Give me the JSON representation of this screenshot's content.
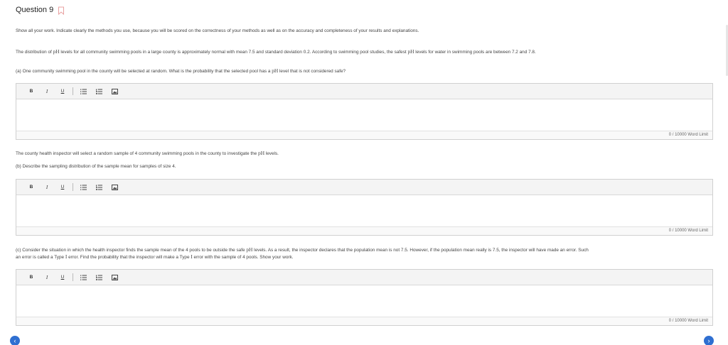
{
  "question": {
    "title": "Question 9"
  },
  "instructions": "Show all your work. Indicate clearly the methods you use, because you will be scored on the correctness of your methods as well as on the accuracy and completeness of your results and explanations.",
  "intro": {
    "part1": "The distribution of ",
    "ph": "pH",
    "part2": " levels for all community swimming pools in a large county is approximately normal with mean 7.5 and standard deviation 0.2. According to swimming pool studies, the safest ",
    "ph2": "pH",
    "part3": " levels for water in swimming pools are between 7.2 and 7.8."
  },
  "part_a": {
    "part1": "(a) One community swimming pool in the county will be selected at random. What is the probability that the selected pool has a ",
    "ph": "pH",
    "part2": " level that is not considered safe?"
  },
  "inspector": {
    "part1": "The county health inspector will select a random sample of 4 community swimming pools in the county to investigate the ",
    "ph": "pH",
    "part2": " levels."
  },
  "part_b": "(b) Describe the sampling distribution of the sample mean for samples of size 4.",
  "part_c": {
    "line1a": "(c) Consider the situation in which the health inspector finds the sample mean of the 4 pools to be outside the safe ",
    "ph": "pH",
    "line1b": " levels. As a result, the inspector declares that the population mean is not 7.5. However, if the population mean really is 7.5, the inspector will have made an error. Such",
    "line2a": "an error is called a Type ",
    "roman": "I",
    "line2b": " error. Find the probability that the inspector will make a Type ",
    "roman2": "I",
    "line2c": " error with the sample of 4 pools. Show your work."
  },
  "editor": {
    "bold": "B",
    "italic": "I",
    "underline": "U",
    "word_limit": "0 / 10000 Word Limit"
  },
  "nav": {
    "prev": "‹",
    "next": "›"
  }
}
